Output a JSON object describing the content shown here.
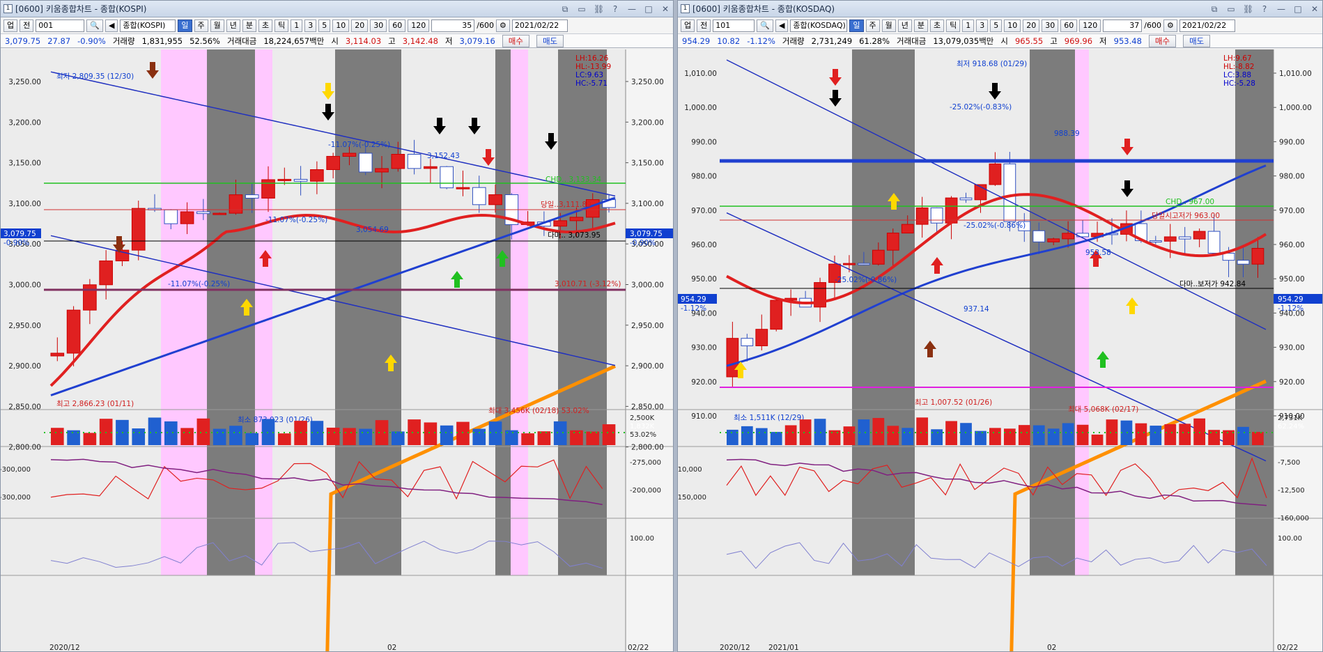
{
  "left": {
    "title": "[0600] 키움종합차트 - 종합(KOSPI)",
    "toolbar": {
      "market": "업",
      "period": "전",
      "code": "001",
      "name": "종합(KOSPI)",
      "intervals": [
        "일",
        "주",
        "월",
        "년",
        "분",
        "초",
        "틱"
      ],
      "numbers": [
        "1",
        "3",
        "5",
        "10",
        "20",
        "30",
        "60",
        "120"
      ],
      "count": "35",
      "count_total": "/600",
      "date": "2021/02/22"
    },
    "quote": {
      "price": "3,079.75",
      "change": "27.87",
      "rate": "-0.90%",
      "vol_label": "거래량",
      "volume": "1,831,955",
      "vol_rate": "52.56%",
      "amt_label": "거래대금",
      "amount": "18,224,657백만",
      "open_label": "시",
      "open": "3,114.03",
      "high_label": "고",
      "high": "3,142.48",
      "low_label": "저",
      "low": "3,079.16",
      "buy": "매수",
      "sell": "매도"
    },
    "y_ticks": [
      "3,250.00",
      "3,200.00",
      "3,150.00",
      "3,100.00",
      "3,050.00",
      "3,000.00",
      "2,950.00",
      "2,900.00",
      "2,850.00",
      "2,800.00"
    ],
    "corner_stats": [
      "LH:16.26",
      "HL:-13.99",
      "LC:9.63",
      "HC:-5.71"
    ],
    "price_tag": "3,079.75",
    "price_rate": "-0.90%",
    "annotations": {
      "max": "최저 2,809.35 (12/30)",
      "min": "최고 2,866.23 (01/11)",
      "pct1": "-11.07%(-0.25%)",
      "pct2": "-11.07%(-0.25%)",
      "pct3": "-11.07%(-0.25%)",
      "val1": "3,152.43",
      "val2": "3,054.69",
      "val3": "3,010.71 (-3.12%)",
      "val4": "3,080",
      "tag1": "다마.. 3,073.95",
      "tag2": "당일..3,111.89",
      "tag3": "CHD.. 3,133.34",
      "vol_min": "최소 873,023 (01/26)",
      "vol_max": "최대 3,456K (02/18) 53.02%"
    },
    "vol_ticks": [
      "2,500K",
      "1,832K",
      "53.02%"
    ],
    "ind1_ticks": [
      "-275,000",
      "-300,000",
      "-200,000",
      "-300,000"
    ],
    "ind2_tick": "100.00",
    "x_labels": [
      "2020/12",
      "02",
      "02/22"
    ]
  },
  "right": {
    "title": "[0600] 키움종합차트 - 종합(KOSDAQ)",
    "toolbar": {
      "market": "업",
      "period": "전",
      "code": "101",
      "name": "종합(KOSDAQ)",
      "intervals": [
        "일",
        "주",
        "월",
        "년",
        "분",
        "초",
        "틱"
      ],
      "numbers": [
        "1",
        "3",
        "5",
        "10",
        "20",
        "30",
        "60",
        "120"
      ],
      "count": "37",
      "count_total": "/600",
      "date": "2021/02/22"
    },
    "quote": {
      "price": "954.29",
      "change": "10.82",
      "rate": "-1.12%",
      "vol_label": "거래량",
      "volume": "2,731,249",
      "vol_rate": "61.28%",
      "amt_label": "거래대금",
      "amount": "13,079,035백만",
      "open_label": "시",
      "open": "965.55",
      "high_label": "고",
      "high": "969.96",
      "low_label": "저",
      "low": "953.48",
      "buy": "매수",
      "sell": "매도"
    },
    "y_ticks": [
      "1,010.00",
      "1,000.00",
      "990.00",
      "980.00",
      "970.00",
      "960.00",
      "950.00",
      "940.00",
      "930.00",
      "920.00",
      "910.00"
    ],
    "corner_stats": [
      "LH:9.67",
      "HL:-8.82",
      "LC:3.88",
      "HC:-5.28"
    ],
    "price_tag": "954.29",
    "price_rate": "-1.12%",
    "annotations": {
      "max": "최저 918.68 (01/29)",
      "min": "최고 1,007.52 (01/26)",
      "pct1": "-25.02%(-0.83%)",
      "pct2": "-25.02%(-0.86%)",
      "pct3": "-25.02%(-0.86%)",
      "val1": "953.58",
      "val2": "937.14",
      "val3": "988.39",
      "tag1": "다마..보저가 942.84",
      "tag2": "당일시고저가 963.00",
      "tag3": "CHD.. 967.00",
      "vol_min": "최소 1,511K (12/29)",
      "vol_max": "최대 5,068K (02/17)",
      "vol_rate": "62.24%"
    },
    "vol_ticks": [
      "2,731K",
      "62.24%"
    ],
    "ind1_ticks": [
      "-7,500",
      "-10,000",
      "-12,500",
      "-150,000",
      "-160,000"
    ],
    "ind2_tick": "100.00",
    "x_labels": [
      "2020/12",
      "2021/01",
      "02",
      "02/22"
    ]
  }
}
